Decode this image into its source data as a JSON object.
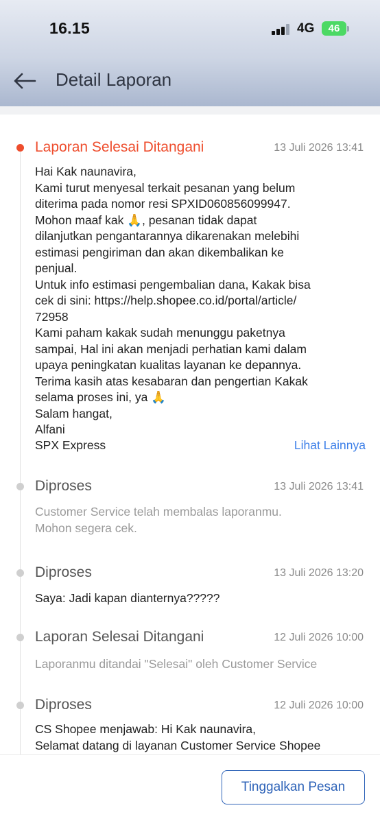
{
  "status_bar": {
    "time": "16.15",
    "network": "4G",
    "battery": "46"
  },
  "header": {
    "title": "Detail Laporan",
    "back_icon": "arrow-left-icon"
  },
  "timeline": [
    {
      "status": "Laporan Selesai Ditangani",
      "timestamp": "13 Juli 2026 13:41",
      "active": true,
      "lines": [
        "Hai Kak naunavira,",
        "Kami turut menyesal terkait pesanan yang belum",
        "diterima pada nomor resi SPXID060856099947.",
        "Mohon maaf kak 🙏, pesanan tidak dapat",
        "dilanjutkan pengantarannya dikarenakan melebihi",
        "estimasi pengiriman dan akan dikembalikan ke",
        "penjual.",
        "Untuk info estimasi pengembalian dana, Kakak bisa",
        "cek di sini: https://help.shopee.co.id/portal/article/",
        "72958",
        "Kami paham kakak sudah menunggu paketnya",
        "sampai, Hal ini akan menjadi perhatian kami dalam",
        "upaya peningkatan kualitas layanan ke depannya.",
        "Terima kasih atas kesabaran dan pengertian Kakak",
        "selama proses ini, ya 🙏",
        "Salam hangat,",
        "Alfani"
      ],
      "signature": "SPX Express",
      "see_more": "Lihat Lainnya"
    },
    {
      "status": "Diproses",
      "timestamp": "13 Juli 2026 13:41",
      "active": false,
      "lines": [
        "Customer Service telah membalas laporanmu.",
        "Mohon segera cek."
      ]
    },
    {
      "status": "Diproses",
      "timestamp": "13 Juli 2026 13:20",
      "active": false,
      "lines": [
        "Saya: Jadi kapan dianternya?????"
      ]
    },
    {
      "status": "Laporan Selesai Ditangani",
      "timestamp": "12 Juli 2026 10:00",
      "active": false,
      "lines": [
        "Laporanmu ditandai \"Selesai\" oleh Customer Service"
      ]
    },
    {
      "status": "Diproses",
      "timestamp": "12 Juli 2026 10:00",
      "active": false,
      "lines": [
        "CS Shopee menjawab: Hi Kak naunavira,",
        "Selamat datang di layanan Customer Service Shopee"
      ]
    }
  ],
  "actions": {
    "leave_message": "Tinggalkan Pesan"
  },
  "colors": {
    "accent": "#ee4d2d",
    "link": "#3b7ee8",
    "button": "#2e63b8"
  }
}
